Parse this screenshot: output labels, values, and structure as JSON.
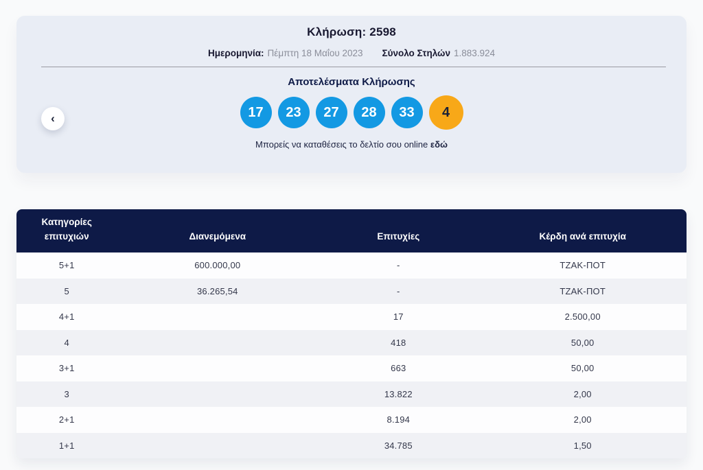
{
  "colors": {
    "page_bg": "#f9fafb",
    "card_bg": "#e9edf5",
    "navy": "#0e1a47",
    "number_ball": "#1399e3",
    "bonus_ball": "#f8a818"
  },
  "draw_card": {
    "title": "Κλήρωση: 2598",
    "date_label": "Ημερομηνία:",
    "date_value": "Πέμπτη 18 Μαΐου 2023",
    "columns_label": "Σύνολο Στηλών",
    "columns_value": "1.883.924",
    "results_title": "Αποτελέσματα Κλήρωσης",
    "numbers": [
      "17",
      "23",
      "27",
      "28",
      "33"
    ],
    "bonus_number": "4",
    "note_text": "Μπορείς να καταθέσεις το δελτίο σου online",
    "note_link": "εδώ"
  },
  "nav": {
    "prev_icon": "‹"
  },
  "results_table": {
    "headers": [
      "Κατηγορίες επιτυχιών",
      "Διανεμόμενα",
      "Επιτυχίες",
      "Κέρδη ανά επιτυχία"
    ],
    "rows": [
      {
        "category": "5+1",
        "distributed": "600.000,00",
        "wins": "-",
        "prize": "ΤΖΑΚ-ΠΟΤ"
      },
      {
        "category": "5",
        "distributed": "36.265,54",
        "wins": "-",
        "prize": "ΤΖΑΚ-ΠΟΤ"
      },
      {
        "category": "4+1",
        "distributed": "",
        "wins": "17",
        "prize": "2.500,00"
      },
      {
        "category": "4",
        "distributed": "",
        "wins": "418",
        "prize": "50,00"
      },
      {
        "category": "3+1",
        "distributed": "",
        "wins": "663",
        "prize": "50,00"
      },
      {
        "category": "3",
        "distributed": "",
        "wins": "13.822",
        "prize": "2,00"
      },
      {
        "category": "2+1",
        "distributed": "",
        "wins": "8.194",
        "prize": "2,00"
      },
      {
        "category": "1+1",
        "distributed": "",
        "wins": "34.785",
        "prize": "1,50"
      }
    ]
  }
}
